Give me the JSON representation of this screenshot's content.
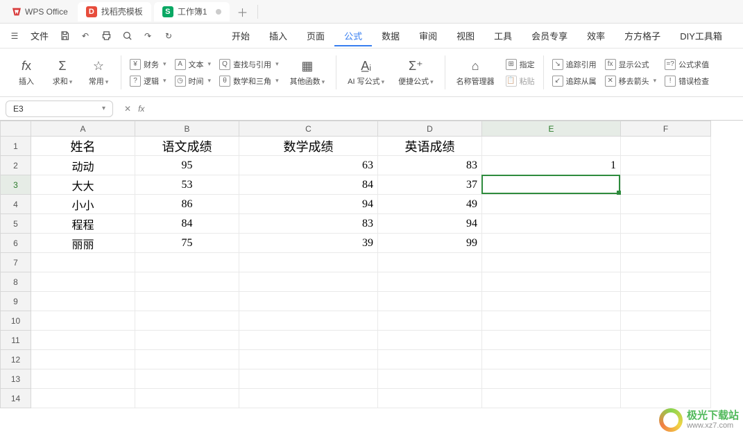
{
  "app": {
    "name": "WPS Office"
  },
  "tabs": {
    "template": {
      "label": "找稻壳模板"
    },
    "active": {
      "label": "工作簿1"
    }
  },
  "quick": {
    "file": "文件"
  },
  "menu": {
    "items": [
      "开始",
      "插入",
      "页面",
      "公式",
      "数据",
      "审阅",
      "视图",
      "工具",
      "会员专享",
      "效率",
      "方方格子",
      "DIY工具箱"
    ],
    "activeIndex": 3
  },
  "ribbon": {
    "insert": "插入",
    "sum": "求和",
    "common": "常用",
    "finance": "财务",
    "text": "文本",
    "lookup": "查找与引用",
    "logic": "逻辑",
    "time": "时间",
    "math": "数学和三角",
    "other": "其他函数",
    "aiwrite": "AI 写公式",
    "quickfx": "便捷公式",
    "namemgr": "名称管理器",
    "assign": "指定",
    "paste": "粘贴",
    "traceRef": "追踪引用",
    "traceDep": "追踪从属",
    "showFx": "显示公式",
    "moveArrow": "移去箭头",
    "fxEval": "公式求值",
    "errCheck": "错误检查"
  },
  "namebox": {
    "value": "E3"
  },
  "fx": {
    "label": "fx",
    "value": ""
  },
  "columns": [
    "A",
    "B",
    "C",
    "D",
    "E",
    "F"
  ],
  "rows": [
    1,
    2,
    3,
    4,
    5,
    6,
    7,
    8,
    9,
    10,
    11,
    12,
    13,
    14
  ],
  "selected": {
    "col": "E",
    "row": 3
  },
  "headers": {
    "A": "姓名",
    "B": "语文成绩",
    "C": "数学成绩",
    "D": "英语成绩"
  },
  "data": [
    {
      "A": "动动",
      "B": "95",
      "C": "63",
      "D": "83",
      "E": "1"
    },
    {
      "A": "大大",
      "B": "53",
      "C": "84",
      "D": "37"
    },
    {
      "A": "小小",
      "B": "86",
      "C": "94",
      "D": "49"
    },
    {
      "A": "程程",
      "B": "84",
      "C": "83",
      "D": "94"
    },
    {
      "A": "丽丽",
      "B": "75",
      "C": "39",
      "D": "99"
    }
  ],
  "watermark": {
    "line1": "极光下载站",
    "line2": "www.xz7.com"
  }
}
